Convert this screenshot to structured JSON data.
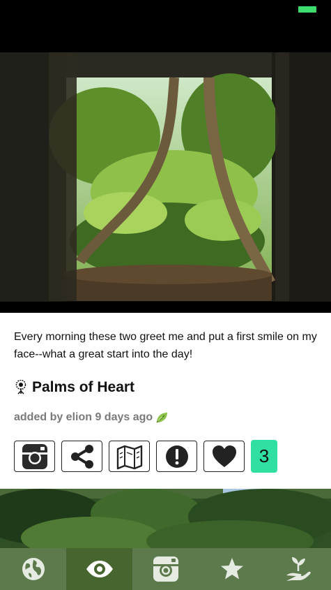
{
  "post": {
    "caption": "Every morning these two greet me and put a first smile on my face--what a great start into the day!",
    "title": "Palms of Heart",
    "added": "added by elion 9 days ago",
    "like_count": "3"
  },
  "actions": [
    {
      "icon": "instagram-icon"
    },
    {
      "icon": "share-icon"
    },
    {
      "icon": "map-icon"
    },
    {
      "icon": "report-icon"
    },
    {
      "icon": "heart-icon"
    }
  ],
  "tabs": [
    {
      "icon": "globe-icon",
      "active": false
    },
    {
      "icon": "eye-icon",
      "active": true
    },
    {
      "icon": "camera-icon",
      "active": false
    },
    {
      "icon": "star-icon",
      "active": false
    },
    {
      "icon": "plant-in-hand-icon",
      "active": false
    }
  ],
  "colors": {
    "battery": "#3ddc6c",
    "count_badge": "#2fe0a0",
    "tab_bar": "#5d7a4c",
    "tab_active": "#47652f"
  }
}
